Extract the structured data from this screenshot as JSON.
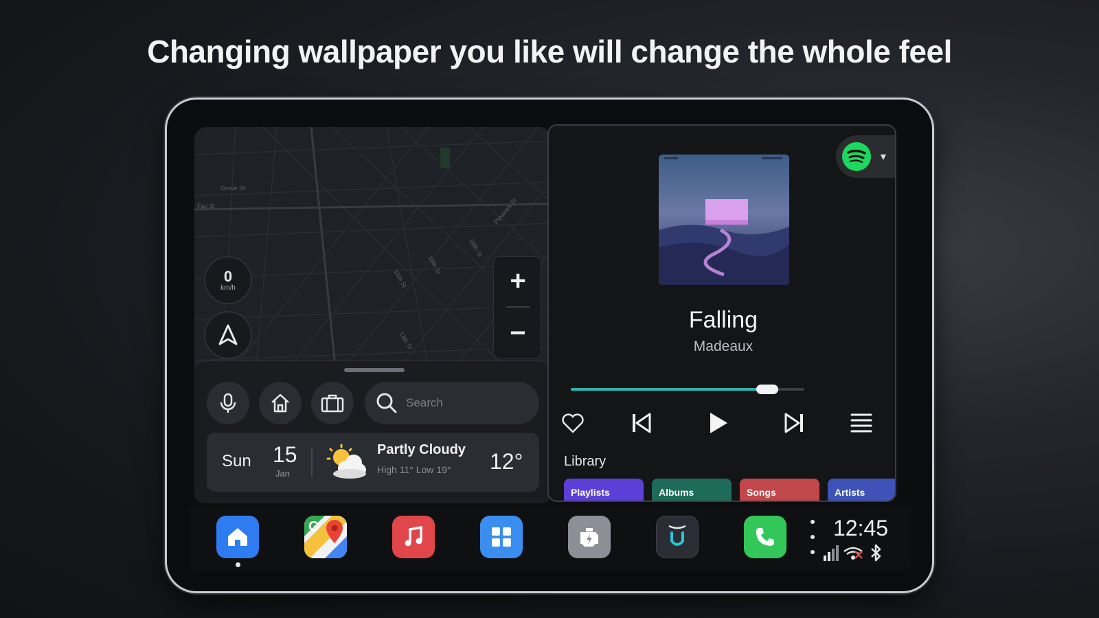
{
  "headline": "Changing wallpaper you like will change the whole feel",
  "map": {
    "speed_value": "0",
    "speed_unit": "km/h",
    "street_labels": [
      "Grove St",
      "Fay St",
      "Pleasant St",
      "18th St",
      "18th St",
      "16th St",
      "13th St"
    ],
    "zoom_in_label": "+",
    "zoom_out_label": "−"
  },
  "widget": {
    "search_placeholder": "Search",
    "weather": {
      "day": "Sun",
      "date": "15",
      "month": "Jan",
      "condition": "Partly Cloudy",
      "high_low": "High 11° Low 19°",
      "temperature": "12°"
    }
  },
  "music": {
    "title": "Falling",
    "artist": "Madeaux",
    "progress": 0.84,
    "service_icon": "spotify-icon",
    "library_label": "Library",
    "library_tabs": [
      {
        "label": "Playlists",
        "color": "#5b3fd6"
      },
      {
        "label": "Albums",
        "color": "#1f6b5a"
      },
      {
        "label": "Songs",
        "color": "#c2474a"
      },
      {
        "label": "Artists",
        "color": "#3e52b8"
      }
    ]
  },
  "dock": {
    "apps": [
      {
        "name": "home-app",
        "color": "#2f7cf0"
      },
      {
        "name": "maps-app",
        "color": "#ffffff"
      },
      {
        "name": "music-app",
        "color": "#e0464a"
      },
      {
        "name": "apps-grid",
        "color": "#3a8ef0"
      },
      {
        "name": "car-settings-app",
        "color": "#8c9096"
      },
      {
        "name": "assistant-app",
        "color": "#2a2d33"
      },
      {
        "name": "phone-app",
        "color": "#33c75a"
      }
    ],
    "clock": "12:45"
  },
  "colors": {
    "accent": "#2bb3ad",
    "spotify": "#1ed760"
  }
}
